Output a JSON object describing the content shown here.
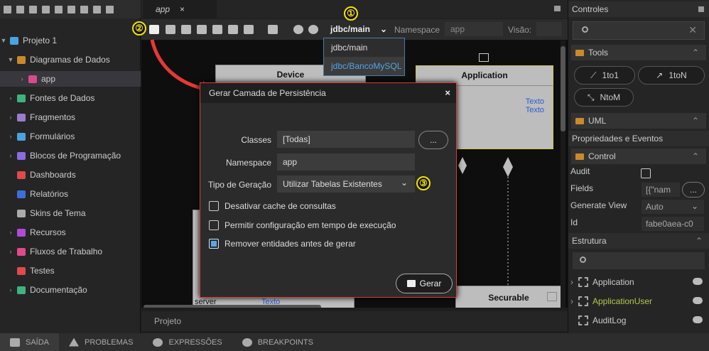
{
  "left_panel": {
    "items": [
      {
        "label": "Projeto 1",
        "color": "#4aa3e0"
      },
      {
        "label": "Diagramas de Dados",
        "color": "#c98a2b"
      },
      {
        "label": "app",
        "color": "#d94a8c"
      },
      {
        "label": "Fontes de Dados",
        "color": "#3fb27f"
      },
      {
        "label": "Fragmentos",
        "color": "#9a7bd0"
      },
      {
        "label": "Formulários",
        "color": "#4aa3e0"
      },
      {
        "label": "Blocos de Programação",
        "color": "#8a6de0"
      },
      {
        "label": "Dashboards",
        "color": "#e04a4a"
      },
      {
        "label": "Relatórios",
        "color": "#3d6fd9"
      },
      {
        "label": "Skins de Tema",
        "color": "#aaaaaa"
      },
      {
        "label": "Recursos",
        "color": "#b04ad9"
      },
      {
        "label": "Fluxos de Trabalho",
        "color": "#e04a8c"
      },
      {
        "label": "Testes",
        "color": "#e04a4a"
      },
      {
        "label": "Documentação",
        "color": "#3fb27f"
      }
    ]
  },
  "editor": {
    "tab_label": "app",
    "tab_close": "×",
    "toolbar": {
      "branch_selected": "jdbc/main",
      "namespace_label": "Namespace",
      "namespace_value": "app",
      "visao_label": "Visão:",
      "branch_options": [
        "jdbc/main",
        "jdbc/BancoMySQL"
      ]
    },
    "canvas": {
      "device_title": "Device",
      "application_title": "Application",
      "application_fields": [
        "Texto",
        "Texto"
      ],
      "securable_title": "Securable",
      "partial_text": [
        "server",
        "Texto"
      ]
    },
    "bottom_tab": "Projeto"
  },
  "modal": {
    "title": "Gerar Camada de Persistência",
    "close": "×",
    "classes_label": "Classes",
    "classes_value": "[Todas]",
    "browse_label": "...",
    "namespace_label": "Namespace",
    "namespace_value": "app",
    "tipo_label": "Tipo de Geração",
    "tipo_value": "Utilizar Tabelas Existentes",
    "options": [
      {
        "label": "Desativar cache de consultas",
        "checked": false
      },
      {
        "label": "Permitir configuração em tempo de execução",
        "checked": false
      },
      {
        "label": "Remover entidades antes de gerar",
        "checked": true
      }
    ],
    "gerar_label": "Gerar"
  },
  "annotations": [
    "①",
    "②",
    "③"
  ],
  "right_panel": {
    "controles_title": "Controles",
    "tools_label": "Tools",
    "tools": [
      "1to1",
      "1toN",
      "NtoM"
    ],
    "uml_label": "UML",
    "props_title": "Propriedades e Eventos",
    "control_label": "Control",
    "props": [
      {
        "name": "Audit",
        "value": ""
      },
      {
        "name": "Fields",
        "value": "[{\"nam"
      },
      {
        "name": "Generate View",
        "value": "Auto"
      },
      {
        "name": "Id",
        "value": "fabe0aea-c0"
      }
    ],
    "fields_button": "...",
    "estrutura_title": "Estrutura",
    "structure_items": [
      {
        "label": "Application",
        "color": "#cccccc"
      },
      {
        "label": "ApplicationUser",
        "color": "#b5c94a"
      },
      {
        "label": "AuditLog",
        "color": "#cccccc"
      }
    ]
  },
  "status_bar": {
    "items": [
      "SAÍDA",
      "PROBLEMAS",
      "EXPRESSÕES",
      "BREAKPOINTS"
    ]
  },
  "colors": {
    "accent_blue": "#4ea6e8",
    "modal_border": "#e53935",
    "annotation_yellow": "#f5e400"
  }
}
